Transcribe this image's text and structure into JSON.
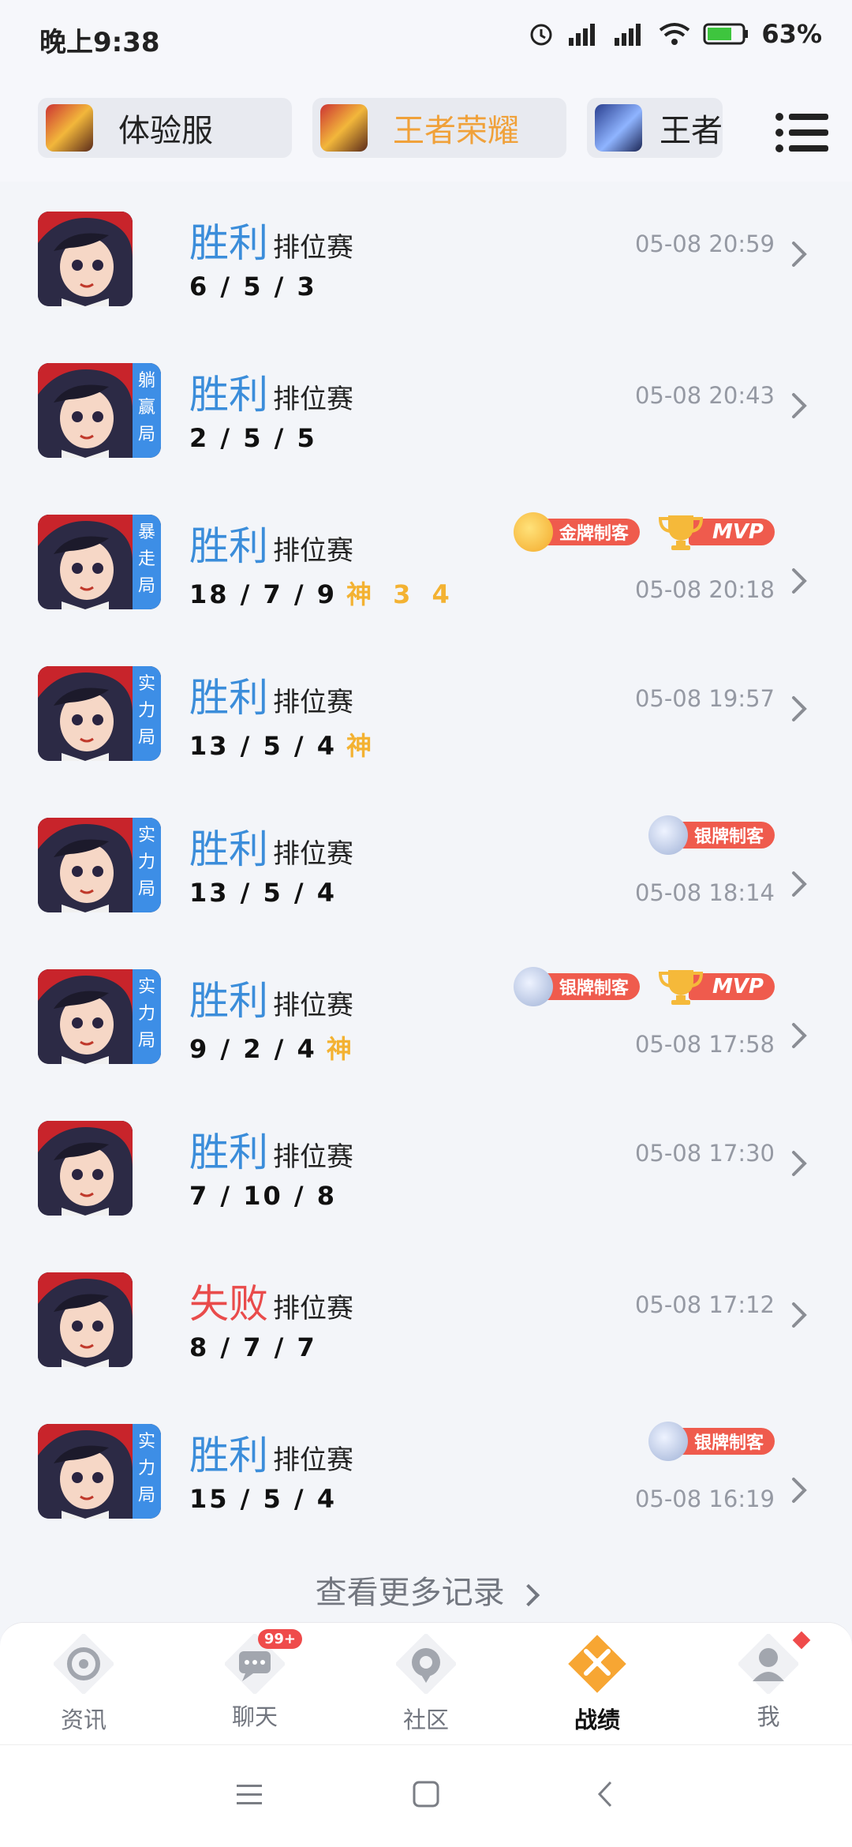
{
  "status": {
    "time": "晚上9:38",
    "battery": "63%"
  },
  "tabs": [
    {
      "label": "体验服",
      "color": "#222222"
    },
    {
      "label": "王者荣耀",
      "color": "#f0a13a"
    },
    {
      "label": "王者",
      "color": "#222222"
    }
  ],
  "records": [
    {
      "result": "胜利",
      "mode": "排位赛",
      "kda": "6 / 5 / 3",
      "extra": "",
      "tag": "",
      "time": "05-08 20:59",
      "badges": []
    },
    {
      "result": "胜利",
      "mode": "排位赛",
      "kda": "2 / 5 / 5",
      "extra": "",
      "tag": "躺赢局",
      "time": "05-08 20:43",
      "badges": []
    },
    {
      "result": "胜利",
      "mode": "排位赛",
      "kda": "18 / 7 / 9",
      "extra": "神 3 4",
      "tag": "暴走局",
      "time": "05-08 20:18",
      "badges": [
        "金牌制客",
        "MVP"
      ]
    },
    {
      "result": "胜利",
      "mode": "排位赛",
      "kda": "13 / 5 / 4",
      "extra": "神",
      "tag": "实力局",
      "time": "05-08 19:57",
      "badges": []
    },
    {
      "result": "胜利",
      "mode": "排位赛",
      "kda": "13 / 5 / 4",
      "extra": "",
      "tag": "实力局",
      "time": "05-08 18:14",
      "badges": [
        "银牌制客"
      ]
    },
    {
      "result": "胜利",
      "mode": "排位赛",
      "kda": "9 / 2 / 4",
      "extra": "神",
      "tag": "实力局",
      "time": "05-08 17:58",
      "badges": [
        "银牌制客",
        "MVP"
      ]
    },
    {
      "result": "胜利",
      "mode": "排位赛",
      "kda": "7 / 10 / 8",
      "extra": "",
      "tag": "",
      "time": "05-08 17:30",
      "badges": []
    },
    {
      "result": "失败",
      "mode": "排位赛",
      "kda": "8 / 7 / 7",
      "extra": "",
      "tag": "",
      "time": "05-08 17:12",
      "badges": []
    },
    {
      "result": "胜利",
      "mode": "排位赛",
      "kda": "15 / 5 / 4",
      "extra": "",
      "tag": "实力局",
      "time": "05-08 16:19",
      "badges": [
        "银牌制客"
      ]
    }
  ],
  "more_link": "查看更多记录",
  "nav": [
    {
      "label": "资讯",
      "icon": "news-icon"
    },
    {
      "label": "聊天",
      "icon": "chat-icon",
      "badge": "99+"
    },
    {
      "label": "社区",
      "icon": "community-icon"
    },
    {
      "label": "战绩",
      "icon": "battle-record-icon",
      "active": true
    },
    {
      "label": "我",
      "icon": "profile-icon",
      "dot": true
    }
  ],
  "colors": {
    "win": "#3b8dda",
    "lose": "#e94b4b",
    "accent": "#f7a633",
    "tag": "#3d8ee6"
  }
}
